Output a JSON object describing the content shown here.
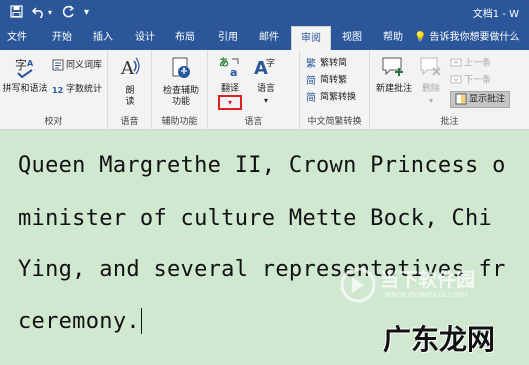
{
  "titlebar": {
    "doc_title": "文档1 - W"
  },
  "tabs": [
    {
      "label": "文件"
    },
    {
      "label": "开始"
    },
    {
      "label": "插入"
    },
    {
      "label": "设计"
    },
    {
      "label": "布局"
    },
    {
      "label": "引用"
    },
    {
      "label": "邮件"
    },
    {
      "label": "审阅"
    },
    {
      "label": "视图"
    },
    {
      "label": "帮助"
    }
  ],
  "tell_me": "告诉我你想要做什么",
  "ribbon": {
    "proofing": {
      "label": "校对",
      "spelling": "拼写和语法",
      "thesaurus": "同义词库",
      "word_count": "字数统计"
    },
    "speech": {
      "label": "语音",
      "read_aloud": "朗读"
    },
    "accessibility": {
      "label": "辅助功能",
      "check": "检查辅助功能"
    },
    "language": {
      "label": "语言",
      "translate": "翻译",
      "language": "语言"
    },
    "chinese_conversion": {
      "label": "中文简繁转换",
      "to_simplified": "繁转简",
      "to_traditional": "简转繁",
      "conversion": "简繁转换"
    },
    "comments": {
      "label": "批注",
      "new_comment": "新建批注",
      "delete": "删除",
      "previous": "上一条",
      "next": "下一条",
      "show_comments": "显示批注"
    }
  },
  "document": {
    "lines": [
      "Queen Margrethe II, Crown Princess o",
      "minister of culture Mette Bock, Chi",
      "Ying, and several representatives fr",
      "ceremony."
    ]
  },
  "watermarks": {
    "site1_name": "当下软件园",
    "site1_url": "www.downxia.com",
    "site2_name": "广东龙网"
  },
  "colors": {
    "titlebar": "#2b579a",
    "ribbon": "#f3f3f3",
    "document_bg": "#cfe8cf",
    "highlight": "#e02020"
  }
}
